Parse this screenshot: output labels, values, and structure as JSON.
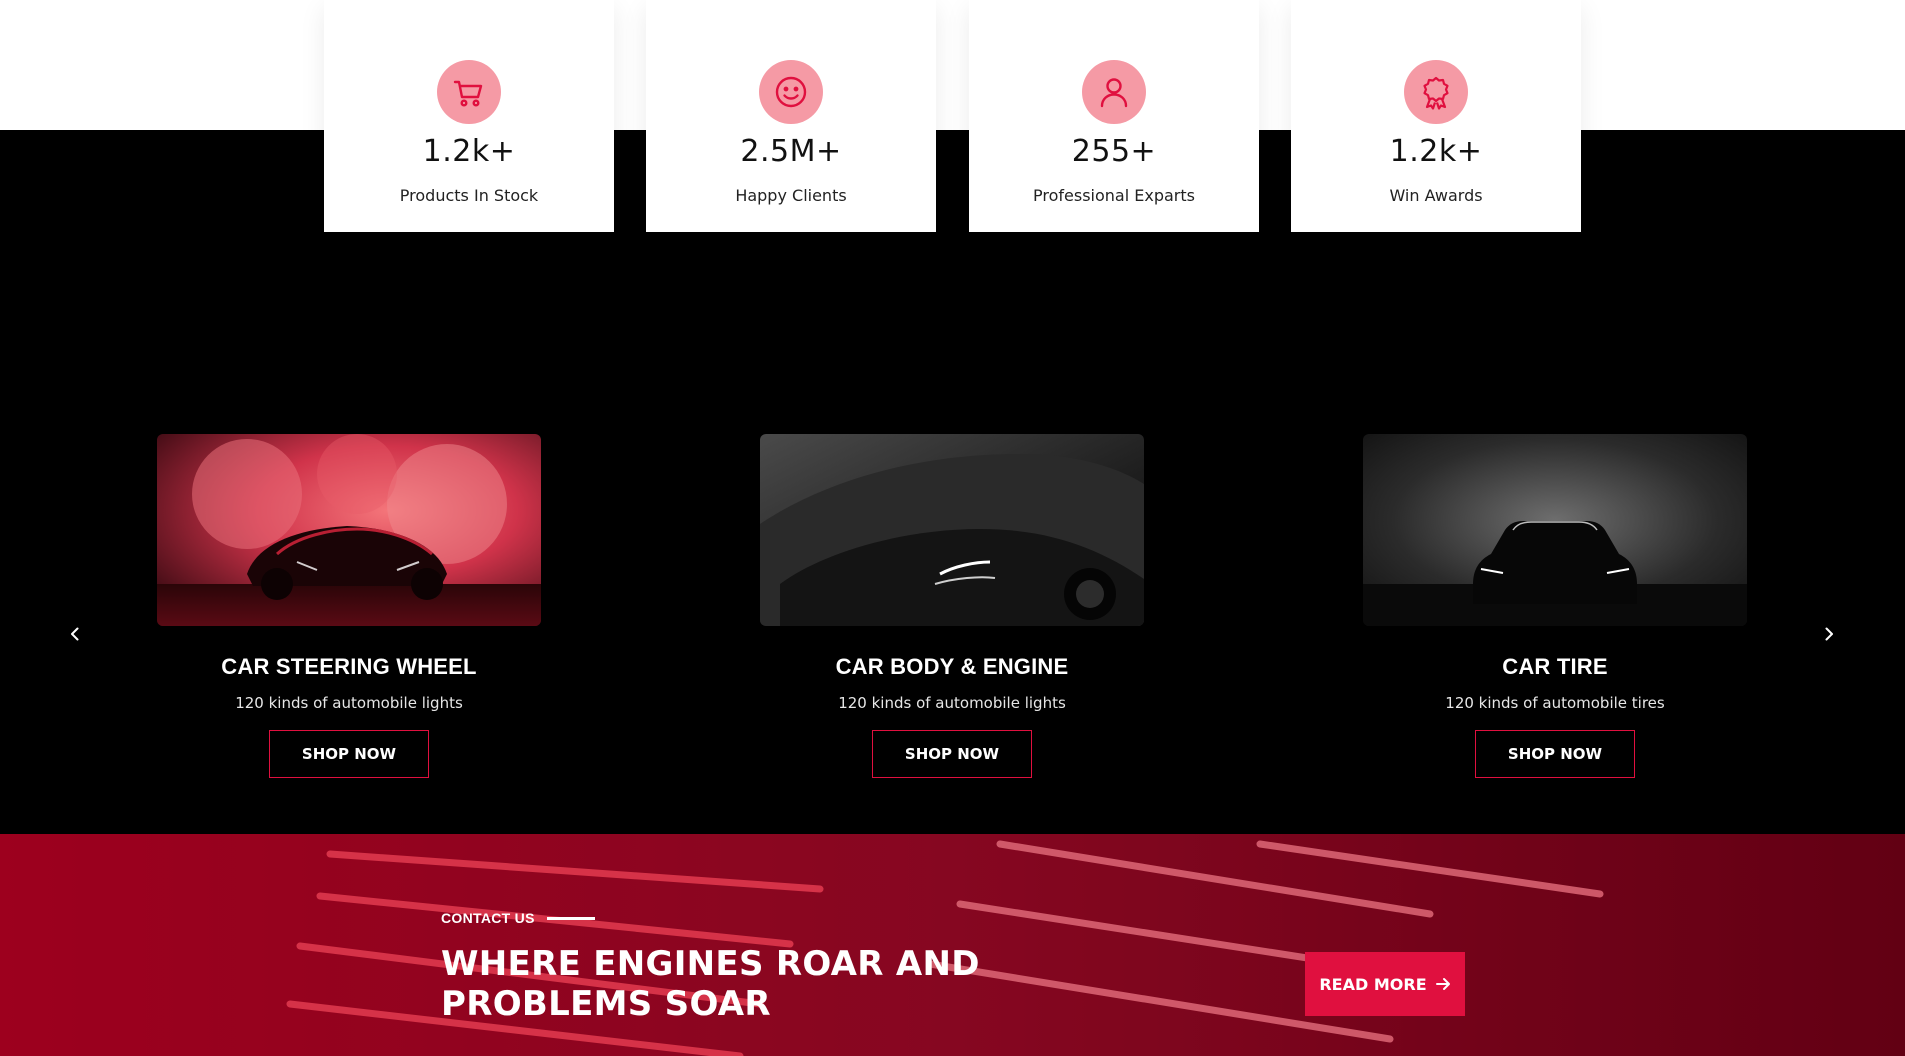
{
  "stats": [
    {
      "value": "1.2k+",
      "label": "Products In Stock",
      "icon": "cart-icon"
    },
    {
      "value": "2.5M+",
      "label": "Happy Clients",
      "icon": "smile-icon"
    },
    {
      "value": "255+",
      "label": "Professional Exparts",
      "icon": "user-icon"
    },
    {
      "value": "1.2k+",
      "label": "Win Awards",
      "icon": "award-icon"
    }
  ],
  "products": [
    {
      "title": "CAR STEERING WHEEL",
      "subtitle": "120 kinds of automobile lights",
      "button": "SHOP NOW"
    },
    {
      "title": "CAR BODY & ENGINE",
      "subtitle": "120 kinds of automobile lights",
      "button": "SHOP NOW"
    },
    {
      "title": "CAR TIRE",
      "subtitle": "120 kinds of automobile tires",
      "button": "SHOP NOW"
    }
  ],
  "slider": {
    "prev_icon": "chevron-left-icon",
    "next_icon": "chevron-right-icon"
  },
  "banner": {
    "kicker": "CONTACT US",
    "title_line1": "WHERE ENGINES ROAR AND",
    "title_line2": "PROBLEMS SOAR",
    "button": "READ MORE",
    "button_icon": "arrow-right-icon"
  },
  "colors": {
    "accent": "#e0103f",
    "icon_bg": "#f59aa5",
    "dark": "#000000",
    "banner": "#7a0016"
  }
}
